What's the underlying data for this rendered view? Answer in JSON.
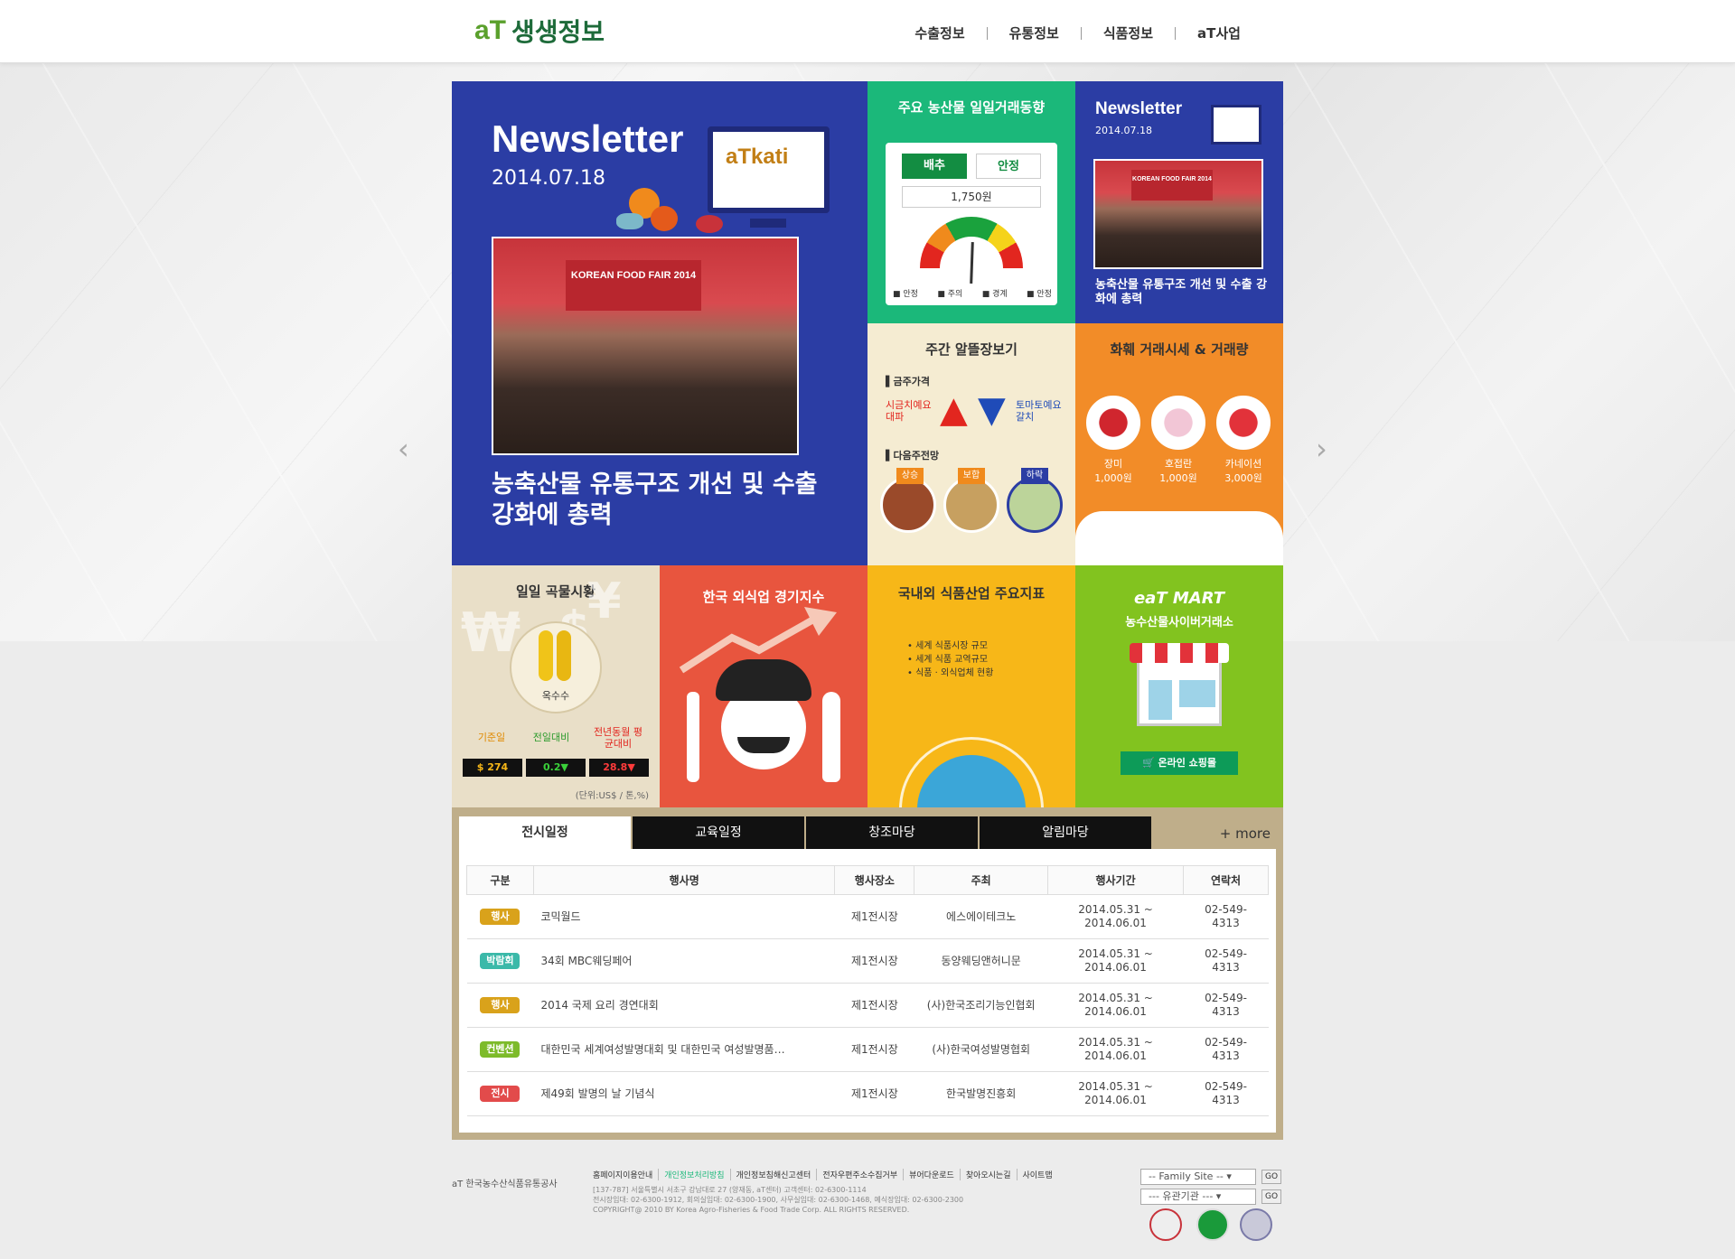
{
  "header": {
    "logo_mark": "aT",
    "logo_text": "생생정보",
    "nav": [
      "수출정보",
      "유통정보",
      "식품정보",
      "aT사업"
    ]
  },
  "newsletter_main": {
    "title": "Newsletter",
    "date": "2014.07.18",
    "monitor_logo": "aTkati",
    "photo_sign": "KOREAN FOOD FAIR 2014",
    "headline": "농축산물 유통구조 개선 및 수출 강화에 총력"
  },
  "trade": {
    "title": "주요 농산물 일일거래동향",
    "tab_active": "배추",
    "tab_other": "안정",
    "price": "1,750원",
    "legend": [
      "안정",
      "주의",
      "경계",
      "안정"
    ]
  },
  "newsletter_small": {
    "title": "Newsletter",
    "date": "2014.07.18",
    "headline": "농축산물 유통구조 개선 및 수출 강화에 총력"
  },
  "weekly": {
    "title": "주간 알뜰장보기",
    "price_label": "금주가격",
    "up_item": "시금치예요 대파",
    "down_item": "토마토예요 갈치",
    "forecast_label": "다음주전망",
    "forecast": [
      "상승",
      "보합",
      "하락"
    ]
  },
  "flower": {
    "title": "화훼 거래시세 & 거래량",
    "items": [
      {
        "name": "장미",
        "price": "1,000원"
      },
      {
        "name": "호접란",
        "price": "1,000원"
      },
      {
        "name": "카네이션",
        "price": "3,000원"
      }
    ]
  },
  "grain": {
    "title": "일일 곡물시황",
    "item": "옥수수",
    "labels": [
      "기준일",
      "전일대비",
      "전년동월 평균대비"
    ],
    "values": [
      "$ 274",
      "0.2▼",
      "28.8▼"
    ],
    "unit": "(단위:US$ / 톤,%)"
  },
  "restaurant": {
    "title": "한국 외식업 경기지수"
  },
  "food": {
    "title": "국내외 식품산업 주요지표",
    "items": [
      "세계 식품시장 규모",
      "세계 식품 교역규모",
      "식품 · 외식업체 현황"
    ]
  },
  "mart": {
    "title": "eaT MART",
    "subtitle": "농수산물사이버거래소",
    "button": "온라인 쇼핑몰"
  },
  "tabs": {
    "items": [
      "전시일정",
      "교육일정",
      "창조마당",
      "알림마당"
    ],
    "more": "+ more",
    "columns": [
      "구분",
      "행사명",
      "행사장소",
      "주최",
      "행사기간",
      "연락처"
    ],
    "rows": [
      {
        "type": "행사",
        "color": "#d9a21b",
        "name": "코믹월드",
        "place": "제1전시장",
        "host": "에스에이테크노",
        "period": "2014.05.31 ~ 2014.06.01",
        "contact": "02-549-4313"
      },
      {
        "type": "박람회",
        "color": "#3bb9a9",
        "name": "34회 MBC웨딩페어",
        "place": "제1전시장",
        "host": "동양웨딩앤허니문",
        "period": "2014.05.31 ~ 2014.06.01",
        "contact": "02-549-4313"
      },
      {
        "type": "행사",
        "color": "#d9a21b",
        "name": "2014 국제 요리 경연대회",
        "place": "제1전시장",
        "host": "(사)한국조리기능인협회",
        "period": "2014.05.31 ~ 2014.06.01",
        "contact": "02-549-4313"
      },
      {
        "type": "컨벤션",
        "color": "#7dbb2a",
        "name": "대한민국 세계여성발명대회 및 대한민국 여성발명품…",
        "place": "제1전시장",
        "host": "(사)한국여성발명협회",
        "period": "2014.05.31 ~ 2014.06.01",
        "contact": "02-549-4313"
      },
      {
        "type": "전시",
        "color": "#e24b4b",
        "name": "제49회 발명의 날 기념식",
        "place": "제1전시장",
        "host": "한국발명진흥회",
        "period": "2014.05.31 ~ 2014.06.01",
        "contact": "02-549-4313"
      }
    ]
  },
  "footer": {
    "org": "aT 한국농수산식품유통공사",
    "links": [
      "홈페이지이용안내",
      "개인정보처리방침",
      "개인정보침해신고센터",
      "전자우편주소수집거부",
      "뷰어다운로드",
      "찾아오시는길",
      "사이트맵"
    ],
    "address": "[137-787] 서울특별시 서초구 강남대로 27 (양재동, aT센터) 고객센터: 02-6300-1114",
    "phone": "전시장임대: 02-6300-1912, 회의실임대: 02-6300-1900, 사무실임대: 02-6300-1468, 예식장임대: 02-6300-2300",
    "copyright": "COPYRIGHT@ 2010 BY Korea Agro-Fisheries & Food Trade Corp. ALL RIGHTS RESERVED.",
    "family_site": "-- Family Site --",
    "related": "--- 유관기관 ---",
    "go": "GO"
  }
}
